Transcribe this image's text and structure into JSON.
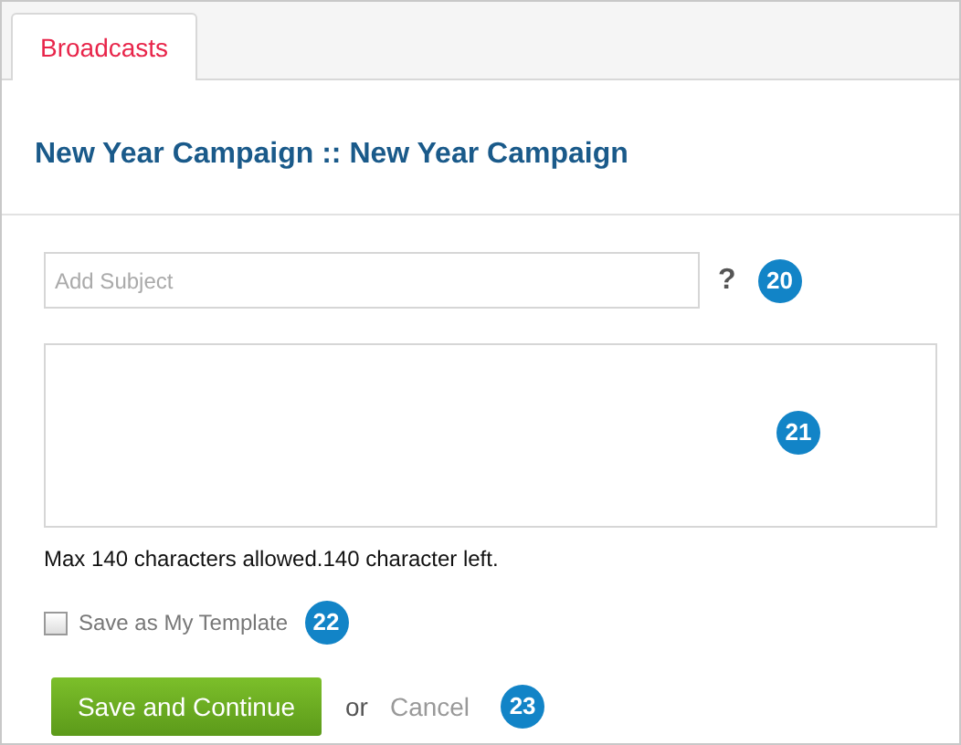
{
  "tabs": [
    {
      "label": "Broadcasts",
      "selected": true
    }
  ],
  "title": "New Year Campaign :: New Year Campaign",
  "subject": {
    "placeholder": "Add Subject",
    "help": "?",
    "callout": "20"
  },
  "message": {
    "callout": "21"
  },
  "limit_note": "Max 140 characters allowed.140 character left.",
  "template": {
    "label": "Save as My Template",
    "checked": false,
    "callout": "22"
  },
  "actions": {
    "primary": "Save and Continue",
    "separator": "or",
    "cancel": "Cancel",
    "callout": "23"
  }
}
